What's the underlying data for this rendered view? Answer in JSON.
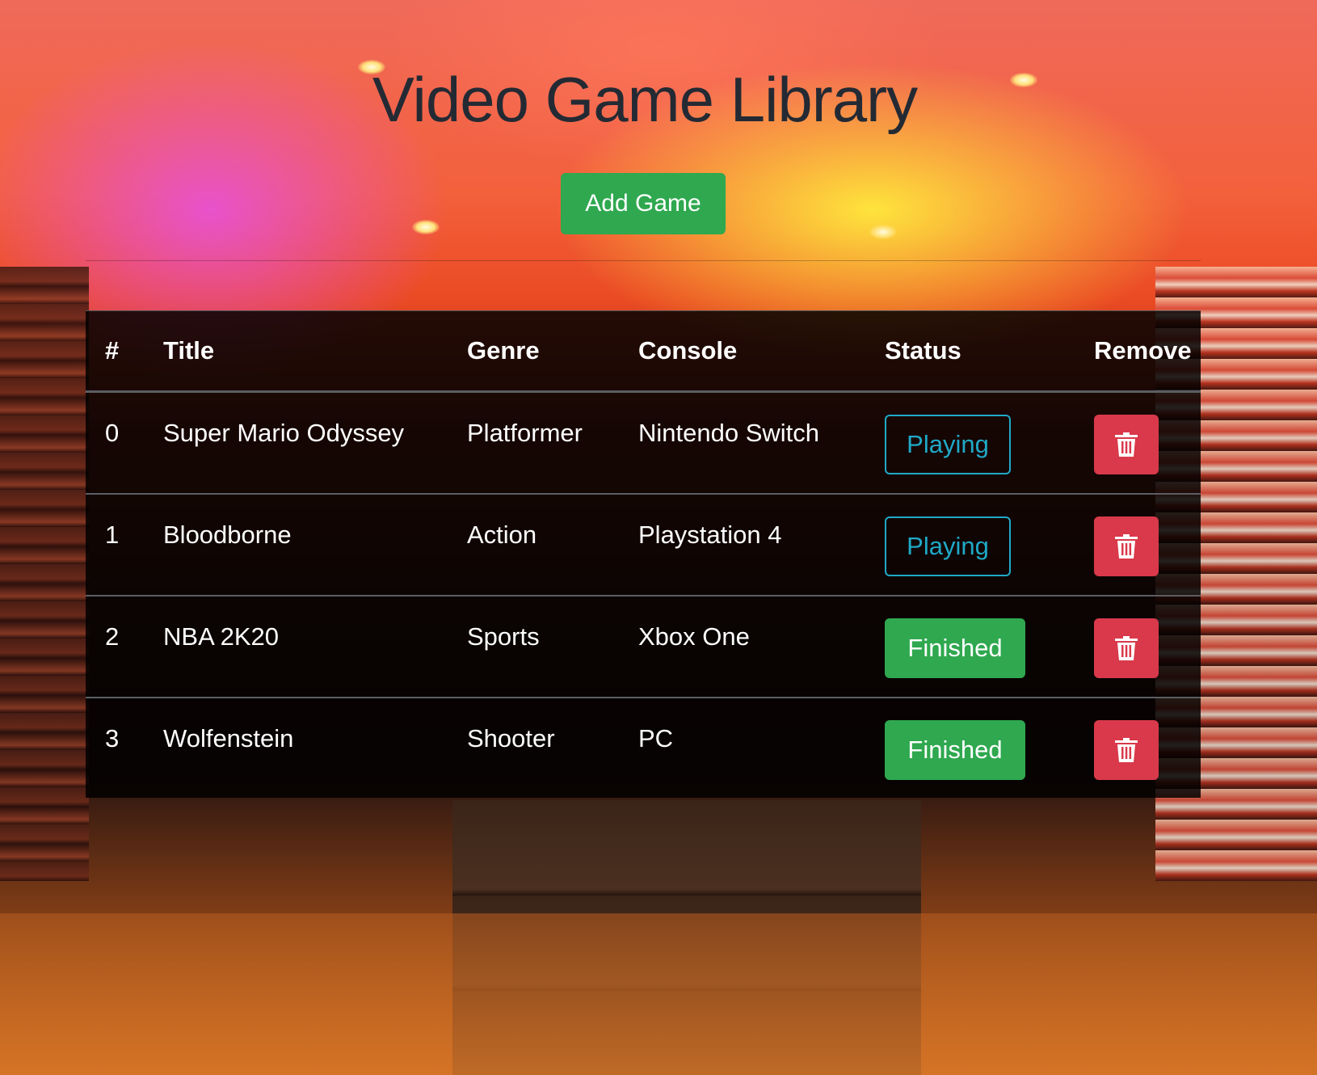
{
  "page": {
    "title": "Video Game Library",
    "add_button_label": "Add Game"
  },
  "table": {
    "headers": [
      "#",
      "Title",
      "Genre",
      "Console",
      "Status",
      "Remove"
    ],
    "rows": [
      {
        "num": "0",
        "title": "Super Mario Odyssey",
        "genre": "Platformer",
        "console": "Nintendo Switch",
        "status": "Playing"
      },
      {
        "num": "1",
        "title": "Bloodborne",
        "genre": "Action",
        "console": "Playstation 4",
        "status": "Playing"
      },
      {
        "num": "2",
        "title": "NBA 2K20",
        "genre": "Sports",
        "console": "Xbox One",
        "status": "Finished"
      },
      {
        "num": "3",
        "title": "Wolfenstein",
        "genre": "Shooter",
        "console": "PC",
        "status": "Finished"
      }
    ],
    "remove_icon": "trash-icon"
  },
  "colors": {
    "success": "#2fa84f",
    "info": "#1fa9c7",
    "danger": "#d9394a",
    "title": "#242a33"
  }
}
